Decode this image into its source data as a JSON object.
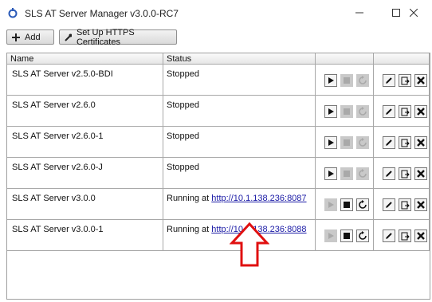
{
  "window": {
    "title": "SLS AT Server Manager v3.0.0-RC7",
    "controls": [
      "minimize-icon",
      "maximize-icon",
      "close-icon"
    ]
  },
  "toolbar": {
    "add_label": "Add",
    "https_label": "Set Up HTTPS Certificates"
  },
  "table": {
    "headers": [
      "Name",
      "Status",
      "",
      ""
    ],
    "rows": [
      {
        "name": "SLS AT Server v2.5.0-BDI",
        "status": "Stopped",
        "running": false,
        "url": ""
      },
      {
        "name": "SLS AT Server v2.6.0",
        "status": "Stopped",
        "running": false,
        "url": ""
      },
      {
        "name": "SLS AT Server v2.6.0-1",
        "status": "Stopped",
        "running": false,
        "url": ""
      },
      {
        "name": "SLS AT Server v2.6.0-J",
        "status": "Stopped",
        "running": false,
        "url": ""
      },
      {
        "name": "SLS AT Server v3.0.0",
        "status": "Running at ",
        "running": true,
        "url": "http://10.1.138.236:8087"
      },
      {
        "name": "SLS AT Server v3.0.0-1",
        "status": "Running at ",
        "running": true,
        "url": "http://10.1.138.236:8088"
      }
    ]
  },
  "colors": {
    "link": "#1a1aa6",
    "annotation_arrow": "#e01010",
    "disabled_button": "#c9c9c9"
  },
  "annotation": {
    "icon": "red-up-arrow",
    "points_to": "http://10.1.138.236:8088"
  }
}
